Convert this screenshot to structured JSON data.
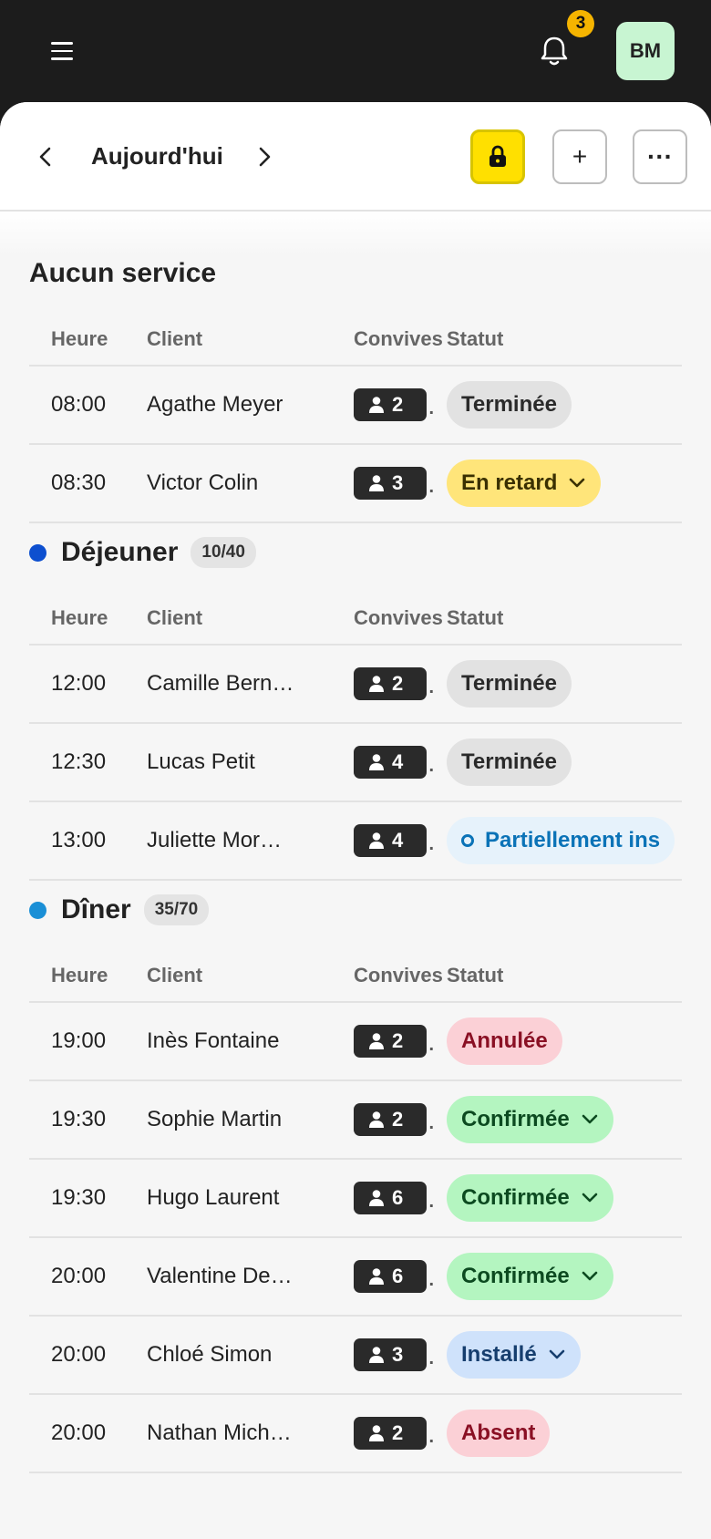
{
  "topbar": {
    "notifications_count": "3",
    "avatar_initials": "BM"
  },
  "toolbar": {
    "date_label": "Aujourd'hui",
    "add_label": "+",
    "more_label": "···"
  },
  "columns": {
    "time": "Heure",
    "client": "Client",
    "guests": "Convives",
    "status": "Statut"
  },
  "sections": [
    {
      "title": "Aucun service",
      "count": "",
      "dot_color": "",
      "rows": [
        {
          "time": "08:00",
          "client": "Agathe Meyer",
          "guests": "2",
          "status": "Terminée",
          "style": "grey",
          "dropdown": false
        },
        {
          "time": "08:30",
          "client": "Victor Colin",
          "guests": "3",
          "status": "En retard",
          "style": "yellow",
          "dropdown": true
        }
      ]
    },
    {
      "title": "Déjeuner",
      "count": "10/40",
      "dot_color": "#0d4fcf",
      "rows": [
        {
          "time": "12:00",
          "client": "Camille Bern…",
          "guests": "2",
          "status": "Terminée",
          "style": "grey",
          "dropdown": false
        },
        {
          "time": "12:30",
          "client": "Lucas Petit",
          "guests": "4",
          "status": "Terminée",
          "style": "grey",
          "dropdown": false
        },
        {
          "time": "13:00",
          "client": "Juliette Mor…",
          "guests": "4",
          "status": "Partiellement ins",
          "style": "blue-outline",
          "dropdown": false
        }
      ]
    },
    {
      "title": "Dîner",
      "count": "35/70",
      "dot_color": "#1a8fd6",
      "rows": [
        {
          "time": "19:00",
          "client": "Inès Fontaine",
          "guests": "2",
          "status": "Annulée",
          "style": "red",
          "dropdown": false
        },
        {
          "time": "19:30",
          "client": "Sophie Martin",
          "guests": "2",
          "status": "Confirmée",
          "style": "green",
          "dropdown": true
        },
        {
          "time": "19:30",
          "client": "Hugo Laurent",
          "guests": "6",
          "status": "Confirmée",
          "style": "green",
          "dropdown": true
        },
        {
          "time": "20:00",
          "client": "Valentine De…",
          "guests": "6",
          "status": "Confirmée",
          "style": "green",
          "dropdown": true
        },
        {
          "time": "20:00",
          "client": "Chloé Simon",
          "guests": "3",
          "status": "Installé",
          "style": "lightblue",
          "dropdown": true
        },
        {
          "time": "20:00",
          "client": "Nathan Mich…",
          "guests": "2",
          "status": "Absent",
          "style": "red",
          "dropdown": false
        }
      ]
    }
  ]
}
